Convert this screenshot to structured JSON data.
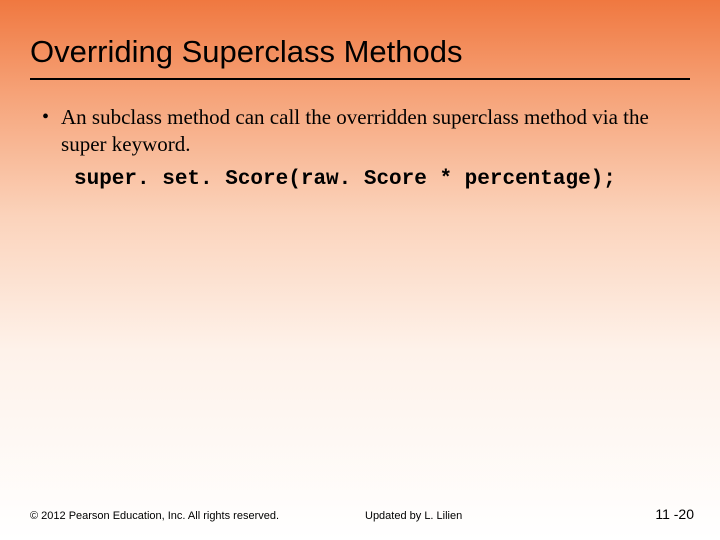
{
  "title": "Overriding Superclass Methods",
  "bullet": {
    "text": "An subclass method can call the overridden superclass method via the super keyword."
  },
  "code": "super. set. Score(raw. Score * percentage);",
  "footer": {
    "copyright": "© 2012 Pearson Education, Inc. All rights reserved.",
    "updated": "Updated by L. Lilien",
    "page": "11 -20"
  }
}
